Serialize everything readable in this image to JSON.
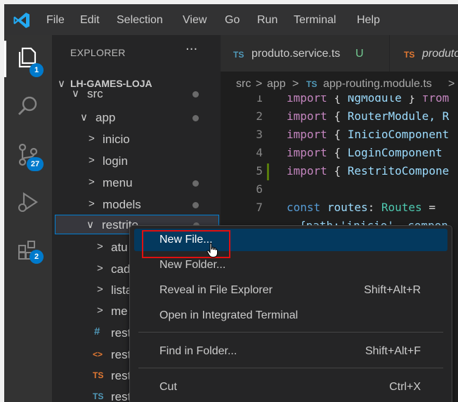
{
  "menubar": [
    "File",
    "Edit",
    "Selection",
    "View",
    "Go",
    "Run",
    "Terminal",
    "Help"
  ],
  "activity": {
    "explorer_badge": "1",
    "scm_badge": "27",
    "extensions_badge": "2"
  },
  "sidebar": {
    "title": "EXPLORER",
    "more": "···",
    "project": "LH-GAMES-LOJA",
    "tree": {
      "src": "src",
      "app": "app",
      "inicio": "inicio",
      "login": "login",
      "menu": "menu",
      "models": "models",
      "restrito": "restrito",
      "atu": "atu",
      "cad": "cad",
      "lista": "lista",
      "me": "me",
      "rest1": "rest",
      "rest2": "rest",
      "rest3": "rest",
      "rest4": "rest"
    },
    "icons": {
      "hash": "#",
      "html": "<>",
      "ts": "TS"
    }
  },
  "tabs": [
    {
      "badge": "TS",
      "label": "produto.service.ts",
      "status": "U"
    },
    {
      "badge": "TS",
      "label": "produto"
    }
  ],
  "breadcrumb": {
    "src": "src",
    "sep": ">",
    "app": "app",
    "ts": "TS",
    "file": "app-routing.module.ts",
    "more": ">"
  },
  "code": {
    "lines": [
      "1",
      "2",
      "3",
      "4",
      "5",
      "6",
      "7"
    ],
    "import": "import",
    "const": "const",
    "ngmodule": "NgModule",
    "from": "from",
    "routermodule": "RouterModule, R",
    "inicio": "InicioComponent",
    "login": "LoginComponent",
    "restrito": "RestritoCompone",
    "routes_var": "routes",
    "routes_type": "Routes",
    "lbrace": "{",
    "rbrace": "}",
    "colon": ":",
    "eq": "=",
    "path": "{path:'inicio', compon"
  },
  "context_menu": {
    "new_file": "New File...",
    "new_folder": "New Folder...",
    "reveal": "Reveal in File Explorer",
    "reveal_key": "Shift+Alt+R",
    "terminal": "Open in Integrated Terminal",
    "find": "Find in Folder...",
    "find_key": "Shift+Alt+F",
    "cut": "Cut",
    "cut_key": "Ctrl+X"
  },
  "colors": {
    "accent": "#007acc",
    "highlight": "#04395e",
    "annotation": "#e01010"
  }
}
